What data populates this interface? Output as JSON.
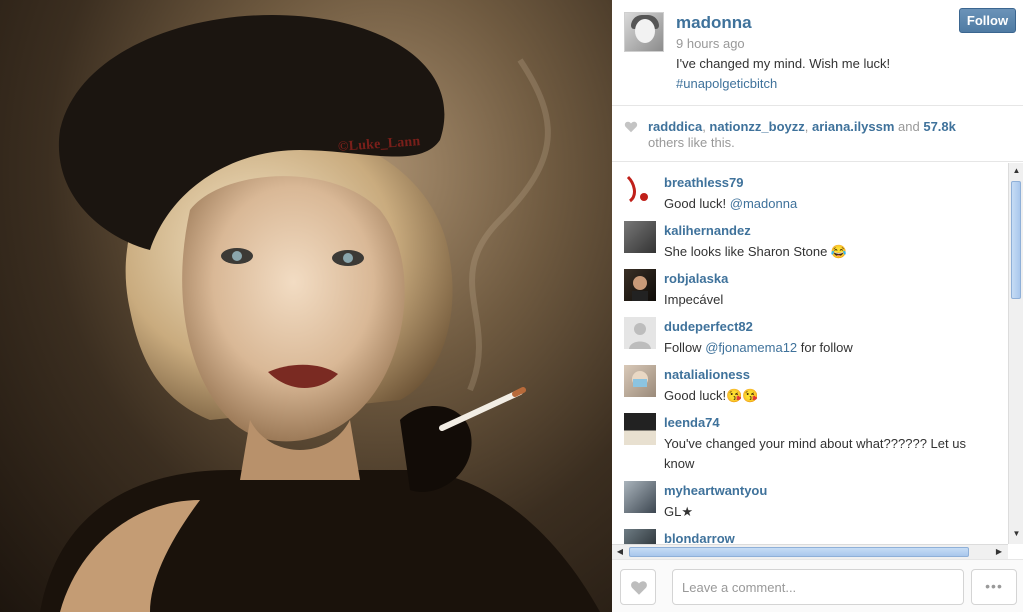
{
  "photo": {
    "watermark": "©Luke_Lann"
  },
  "post": {
    "username": "madonna",
    "time": "9 hours ago",
    "caption": "I've changed my mind. Wish me luck!",
    "hashtag": "#unapolgeticbitch",
    "follow_label": "Follow"
  },
  "likes": {
    "users": [
      "radddica",
      "nationzz_boyzz",
      "ariana.ilyssm"
    ],
    "and_text": "and",
    "count": "57.8k",
    "tail": "others like this."
  },
  "comments": [
    {
      "user": "breathless79",
      "text_before": "Good luck! ",
      "mention": "@madonna",
      "text_after": ""
    },
    {
      "user": "kalihernandez",
      "text_before": "She looks like Sharon Stone 😂",
      "mention": "",
      "text_after": ""
    },
    {
      "user": "robjalaska",
      "text_before": "Impecável",
      "mention": "",
      "text_after": ""
    },
    {
      "user": "dudeperfect82",
      "text_before": "Follow ",
      "mention": "@fjonamema12",
      "text_after": " for follow"
    },
    {
      "user": "natalialioness",
      "text_before": "Good luck!😘😘",
      "mention": "",
      "text_after": ""
    },
    {
      "user": "leenda74",
      "text_before": "You've changed your mind about what?????? Let us know",
      "mention": "",
      "text_after": ""
    },
    {
      "user": "myheartwantyou",
      "text_before": "GL★",
      "mention": "",
      "text_after": ""
    },
    {
      "user": "blondarrow",
      "text_before": "",
      "mention": "",
      "text_after": ""
    }
  ],
  "footer": {
    "comment_placeholder": "Leave a comment...",
    "more_label": "•••"
  },
  "icons": {
    "like": "heart-icon",
    "more": "more-dots-icon"
  },
  "colors": {
    "link": "#3f729b",
    "follow": "#4f7ba3",
    "muted": "#999999"
  }
}
